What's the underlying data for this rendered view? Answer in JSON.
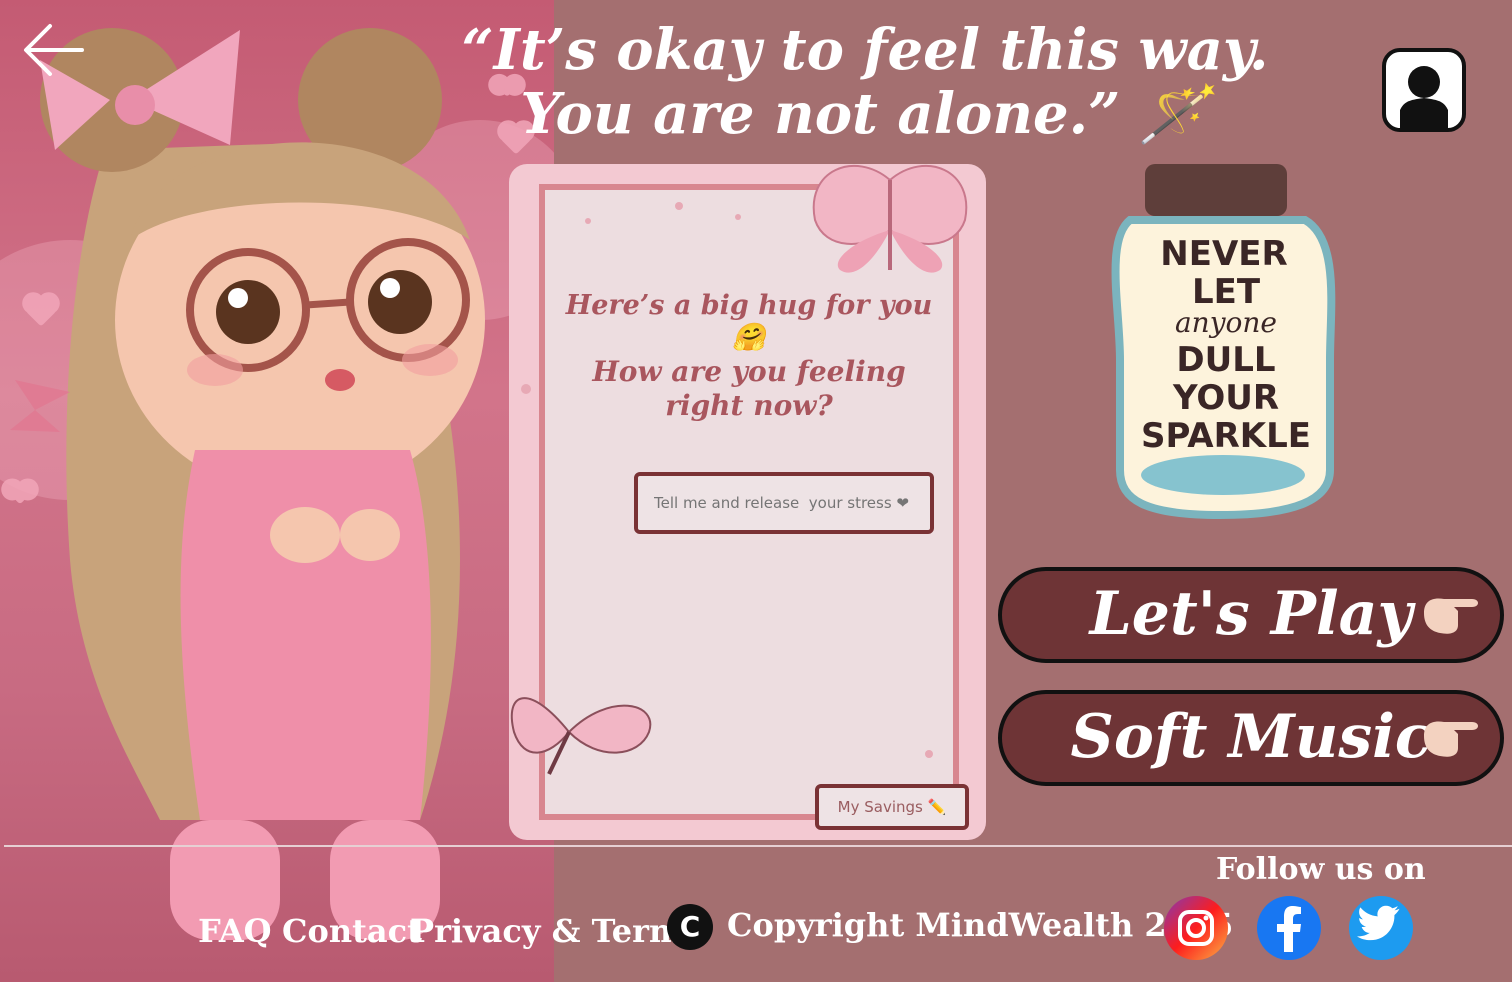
{
  "hero": {
    "quote": "“It’s okay to feel this way. You are not alone.” 🪄"
  },
  "card": {
    "hug_text": "Here’s a big hug for you 🤗",
    "question": "How are you feeling right now?",
    "input_placeholder": "Tell me and release  your stress ❤",
    "savings_label": "My Savings ✏️"
  },
  "jar": {
    "line1": "NEVER",
    "line2": "LET",
    "line3": "anyone",
    "line4": "DULL",
    "line5": "YOUR",
    "line6": "SPARKLE"
  },
  "actions": {
    "play_label": "Let's Play",
    "music_label": "Soft Music"
  },
  "footer": {
    "faq": "FAQ",
    "contact": "Contact",
    "privacy": "Privacy & Terms",
    "copy_symbol": "C",
    "copyright": "Copyright MindWealth 2025",
    "follow": "Follow us on"
  },
  "icons": {
    "back": "arrow-left-icon",
    "avatar": "user-silhouette-icon",
    "pointing": "pointing-right-hand-icon",
    "instagram": "instagram-icon",
    "facebook": "facebook-icon",
    "twitter": "twitter-icon"
  },
  "colors": {
    "page_bg": "#a46f70",
    "button_bg": "#6e3436",
    "card_text": "#a9565e"
  }
}
